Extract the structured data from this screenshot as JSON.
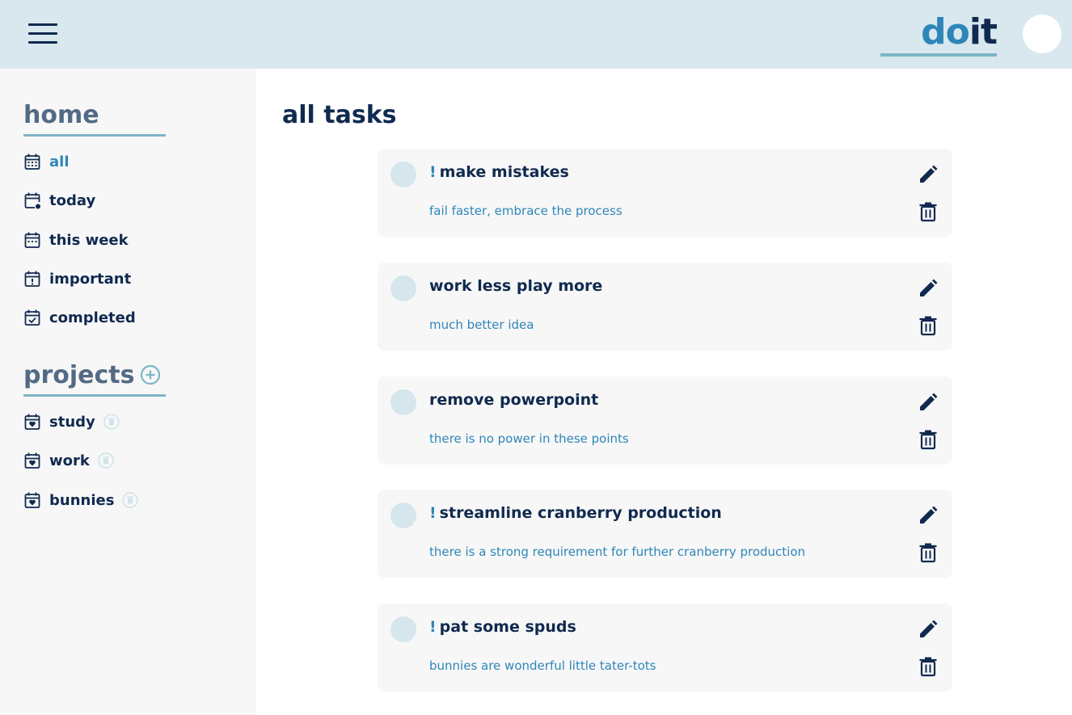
{
  "header": {
    "menu_icon": "hamburger-menu-icon",
    "logo_do": "do",
    "logo_it": "it",
    "avatar": "user-avatar"
  },
  "sidebar": {
    "home_title": "home",
    "nav_items": [
      {
        "label": "all",
        "icon": "calendar-grid-icon",
        "active": true
      },
      {
        "label": "today",
        "icon": "calendar-today-icon",
        "active": false
      },
      {
        "label": "this week",
        "icon": "calendar-week-icon",
        "active": false
      },
      {
        "label": "important",
        "icon": "calendar-important-icon",
        "active": false
      },
      {
        "label": "completed",
        "icon": "calendar-check-icon",
        "active": false
      }
    ],
    "projects_title": "projects",
    "add_project_icon": "plus-circle-icon",
    "projects": [
      {
        "label": "study",
        "icon": "calendar-heart-icon"
      },
      {
        "label": "work",
        "icon": "calendar-heart-icon"
      },
      {
        "label": "bunnies",
        "icon": "calendar-heart-icon"
      }
    ]
  },
  "main": {
    "title": "all tasks",
    "tasks": [
      {
        "title": "make mistakes",
        "important": true,
        "bang": "!",
        "description": "fail faster, embrace the process"
      },
      {
        "title": "work less play more",
        "important": false,
        "bang": "",
        "description": "much better idea"
      },
      {
        "title": "remove powerpoint",
        "important": false,
        "bang": "",
        "description": "there is no power in these points"
      },
      {
        "title": "streamline cranberry production",
        "important": true,
        "bang": "!",
        "description": "there is a strong requirement for further cranberry production"
      },
      {
        "title": "pat some spuds",
        "important": true,
        "bang": "!",
        "description": "bunnies are wonderful little tater-tots"
      }
    ]
  },
  "colors": {
    "header_bg": "#d8e8ee",
    "navy": "#102a4f",
    "accent": "#2e86b8",
    "underline": "#7db5c5",
    "sidebar_bg": "#f7f7f7",
    "section_title": "#536a85"
  }
}
